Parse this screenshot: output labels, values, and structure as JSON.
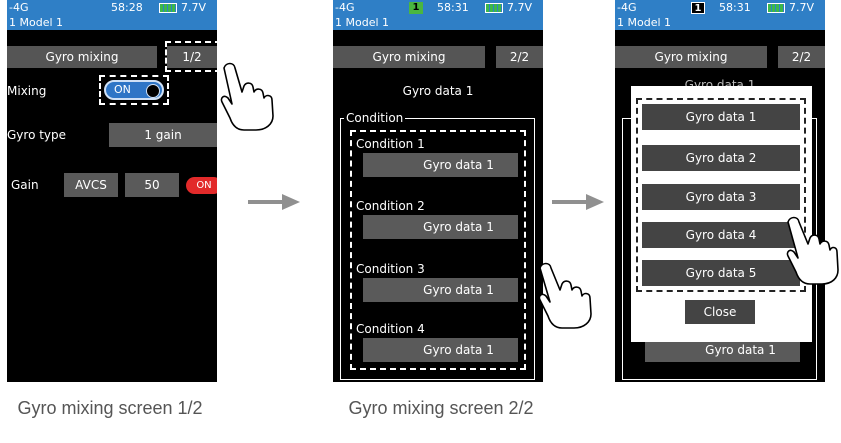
{
  "status": {
    "system": "-4G",
    "model_flag": "1",
    "voltage": "7.7V"
  },
  "screen1": {
    "time": "58:28",
    "model_name": "1  Model 1",
    "title": "Gyro mixing",
    "page": "1/2",
    "mixing_label": "Mixing",
    "mixing_value": "ON",
    "gyro_type_label": "Gyro type",
    "gyro_type_value": "1 gain",
    "gain_label": "Gain",
    "gain_mode": "AVCS",
    "gain_value": "50",
    "gain_switch": "ON",
    "caption": "Gyro mixing screen 1/2"
  },
  "screen2": {
    "time": "58:31",
    "model_name": "1  Model 1",
    "title": "Gyro mixing",
    "page": "2/2",
    "gyro_data_title": "Gyro data 1",
    "condition_legend": "Condition",
    "conditions": [
      {
        "label": "Condition 1",
        "value": "Gyro data 1"
      },
      {
        "label": "Condition 2",
        "value": "Gyro data 1"
      },
      {
        "label": "Condition 3",
        "value": "Gyro data 1"
      },
      {
        "label": "Condition 4",
        "value": "Gyro data 1"
      }
    ],
    "caption": "Gyro mixing screen 2/2"
  },
  "screen3": {
    "time": "58:31",
    "model_name": "1  Model 1",
    "title": "Gyro mixing",
    "page": "2/2",
    "options": [
      "Gyro data 1",
      "Gyro data 2",
      "Gyro data 3",
      "Gyro data 4",
      "Gyro data 5"
    ],
    "close_label": "Close",
    "behind_value": "Gyro data 1",
    "behind_title": "Gyro data 1"
  },
  "colors": {
    "header_blue": "#2f7fc6",
    "button_gray": "#5a5a5a",
    "on_red": "#e22a2a",
    "toggle_blue": "#2e75c6",
    "flag_green": "#4ab640"
  },
  "icons": [
    "pointing-hand-icon",
    "right-arrow-icon",
    "battery-icon"
  ]
}
